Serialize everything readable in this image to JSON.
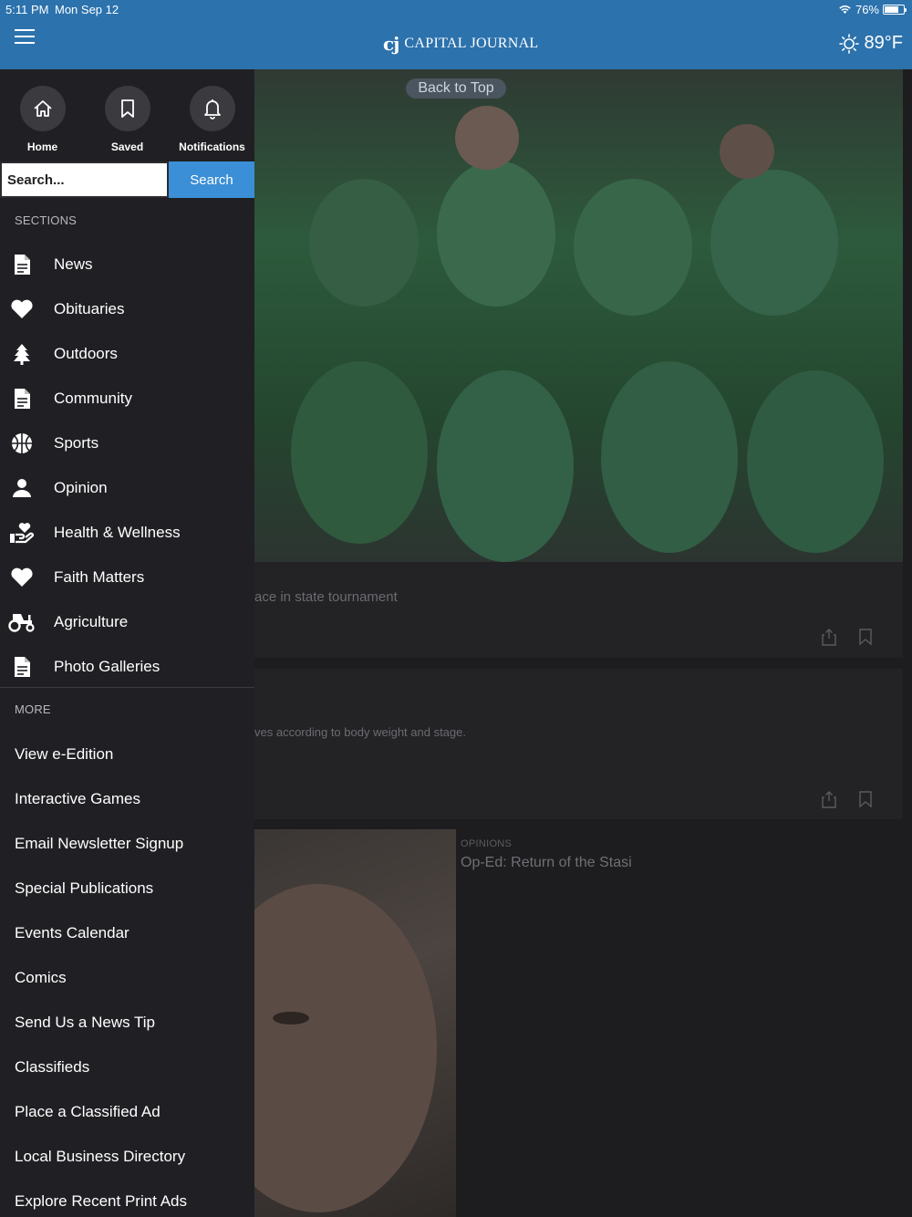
{
  "status_bar": {
    "time": "5:11 PM",
    "date": "Mon Sep 12",
    "battery": "76%",
    "battery_level": 0.76
  },
  "header": {
    "logo_mark": "cj",
    "title": "CAPITAL JOURNAL",
    "weather": "89°F",
    "menu_icon": "hamburger-icon",
    "weather_icon": "sun-icon"
  },
  "main": {
    "back_to_top": "Back to Top",
    "card1_text": "ace in state tournament",
    "card2_text": "ves according to body weight and stage.",
    "opinion_category": "OPINIONS",
    "opinion_title": "Op-Ed: Return of the Stasi"
  },
  "drawer": {
    "quick": [
      {
        "label": "Home",
        "icon": "home-icon"
      },
      {
        "label": "Saved",
        "icon": "bookmark-icon"
      },
      {
        "label": "Notifications",
        "icon": "bell-icon"
      }
    ],
    "search": {
      "placeholder": "Search...",
      "button": "Search"
    },
    "sections_heading": "SECTIONS",
    "sections": [
      {
        "label": "News",
        "icon": "document-icon"
      },
      {
        "label": "Obituaries",
        "icon": "heart-icon"
      },
      {
        "label": "Outdoors",
        "icon": "tree-icon"
      },
      {
        "label": "Community",
        "icon": "document-icon"
      },
      {
        "label": "Sports",
        "icon": "basketball-icon"
      },
      {
        "label": "Opinion",
        "icon": "person-icon"
      },
      {
        "label": "Health & Wellness",
        "icon": "hand-heart-icon"
      },
      {
        "label": "Faith Matters",
        "icon": "heart-icon"
      },
      {
        "label": "Agriculture",
        "icon": "tractor-icon"
      },
      {
        "label": "Photo Galleries",
        "icon": "document-icon"
      }
    ],
    "more_heading": "MORE",
    "more": [
      "View e-Edition",
      "Interactive Games",
      "Email Newsletter Signup",
      "Special Publications",
      "Events Calendar",
      "Comics",
      "Send Us a News Tip",
      "Classifieds",
      "Place a Classified Ad",
      "Local Business Directory",
      "Explore Recent Print Ads"
    ]
  },
  "colors": {
    "header": "#2c72ad",
    "drawer": "#202024",
    "search_button": "#3a8fd6"
  }
}
